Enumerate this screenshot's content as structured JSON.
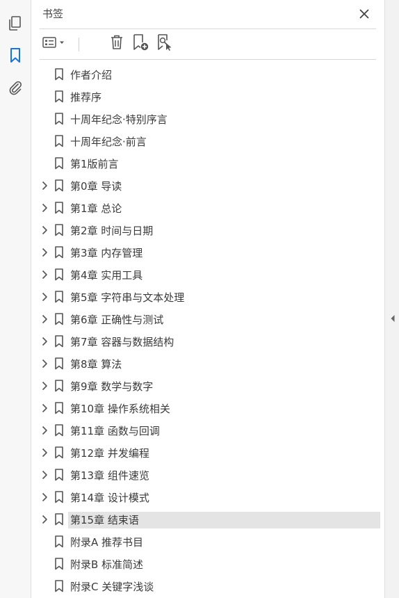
{
  "sidebar": {
    "tools": [
      {
        "icon": "copy-pages-icon"
      },
      {
        "icon": "bookmark-icon",
        "active": true
      },
      {
        "icon": "paperclip-icon"
      }
    ]
  },
  "panel": {
    "title": "书签",
    "close_icon": "close-icon",
    "toolbar": {
      "options_icon": "bookmark-options-icon",
      "delete_icon": "trash-icon",
      "new_icon": "new-bookmark-icon",
      "find_icon": "find-bookmark-icon"
    },
    "bookmarks": [
      {
        "label": "作者介绍",
        "expandable": false
      },
      {
        "label": "推荐序",
        "expandable": false
      },
      {
        "label": "十周年纪念·特别序言",
        "expandable": false
      },
      {
        "label": "十周年纪念·前言",
        "expandable": false
      },
      {
        "label": "第1版前言",
        "expandable": false
      },
      {
        "label": "第0章 导读",
        "expandable": true
      },
      {
        "label": "第1章 总论",
        "expandable": true
      },
      {
        "label": "第2章 时间与日期",
        "expandable": true
      },
      {
        "label": "第3章 内存管理",
        "expandable": true
      },
      {
        "label": "第4章 实用工具",
        "expandable": true
      },
      {
        "label": "第5章 字符串与文本处理",
        "expandable": true
      },
      {
        "label": "第6章 正确性与测试",
        "expandable": true
      },
      {
        "label": "第7章 容器与数据结构",
        "expandable": true
      },
      {
        "label": "第8章 算法",
        "expandable": true
      },
      {
        "label": "第9章 数学与数字",
        "expandable": true
      },
      {
        "label": "第10章 操作系统相关",
        "expandable": true
      },
      {
        "label": "第11章 函数与回调",
        "expandable": true
      },
      {
        "label": "第12章 并发编程",
        "expandable": true
      },
      {
        "label": "第13章 组件速览",
        "expandable": true
      },
      {
        "label": "第14章 设计模式",
        "expandable": true
      },
      {
        "label": "第15章 结束语",
        "expandable": true,
        "selected": true
      },
      {
        "label": "附录A 推荐书目",
        "expandable": false
      },
      {
        "label": "附录B 标准简述",
        "expandable": false
      },
      {
        "label": "附录C 关键字浅谈",
        "expandable": false
      }
    ]
  },
  "colors": {
    "accent": "#1473e6",
    "icon": "#555555",
    "selected_bg": "#e4e4e4"
  }
}
